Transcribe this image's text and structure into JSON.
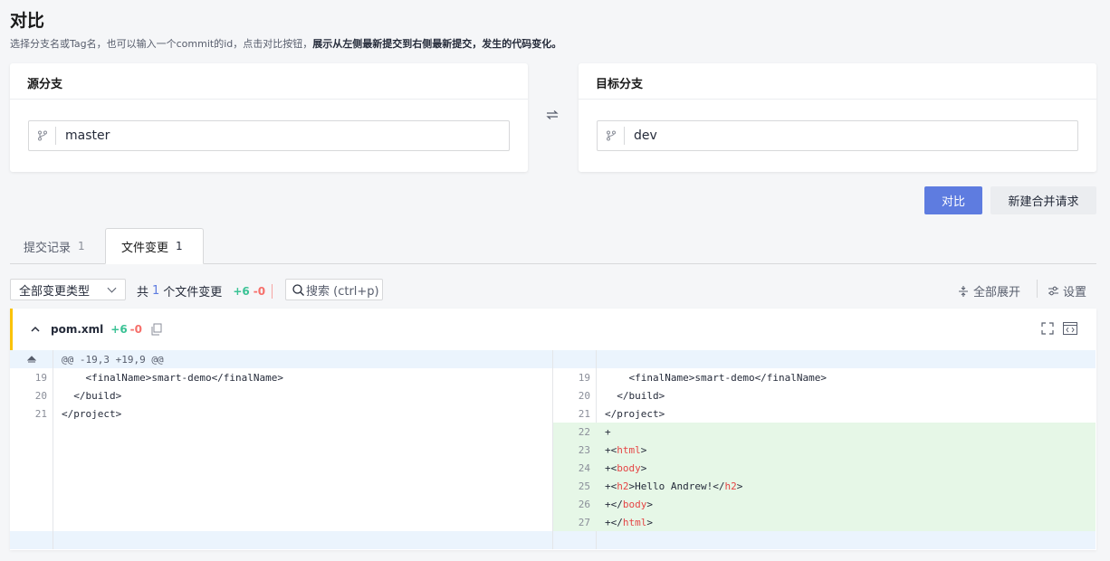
{
  "page": {
    "title": "对比",
    "subtitle_plain": "选择分支名或Tag名，也可以输入一个commit的id，点击对比按钮，",
    "subtitle_bold": "展示从左侧最新提交到右侧最新提交，发生的代码变化。"
  },
  "source": {
    "label": "源分支",
    "value": "master",
    "icon": "branch-icon"
  },
  "target": {
    "label": "目标分支",
    "value": "dev",
    "icon": "branch-icon"
  },
  "swap_icon": "swap-icon",
  "actions": {
    "compare": "对比",
    "new_merge": "新建合并请求"
  },
  "tabs": [
    {
      "label": "提交记录",
      "count": "1"
    },
    {
      "label": "文件变更",
      "count": "1"
    }
  ],
  "toolbar": {
    "filter_value": "全部变更类型",
    "summary_prefix": "共",
    "summary_count": "1",
    "summary_suffix": "个文件变更",
    "additions": "+6",
    "deletions": "-0",
    "search_label": "搜索 (ctrl+p)",
    "expand_all": "全部展开",
    "settings": "设置"
  },
  "file": {
    "name": "pom.xml",
    "additions": "+6",
    "deletions": "-0",
    "hunk": "@@ -19,3 +19,9 @@",
    "left_lines": [
      {
        "n": "19",
        "text": "    <finalName>smart-demo</finalName>"
      },
      {
        "n": "20",
        "text": "  </build>"
      },
      {
        "n": "21",
        "text": "</project>"
      }
    ],
    "right_lines": [
      {
        "n": "19",
        "text": "    <finalName>smart-demo</finalName>"
      },
      {
        "n": "20",
        "text": "  </build>"
      },
      {
        "n": "21",
        "text": "</project>"
      }
    ],
    "added_lines": [
      {
        "n": "22",
        "pre": "+",
        "tag": "",
        "post": ""
      },
      {
        "n": "23",
        "pre": "+<",
        "tag": "html",
        "post": ">"
      },
      {
        "n": "24",
        "pre": "+<",
        "tag": "body",
        "post": ">"
      },
      {
        "n": "25",
        "pre": "+<",
        "tag": "h2",
        "post": ">Hello Andrew!</",
        "tag2": "h2",
        "post2": ">"
      },
      {
        "n": "26",
        "pre": "+</",
        "tag": "body",
        "post": ">"
      },
      {
        "n": "27",
        "pre": "+</",
        "tag": "html",
        "post": ">"
      }
    ]
  }
}
